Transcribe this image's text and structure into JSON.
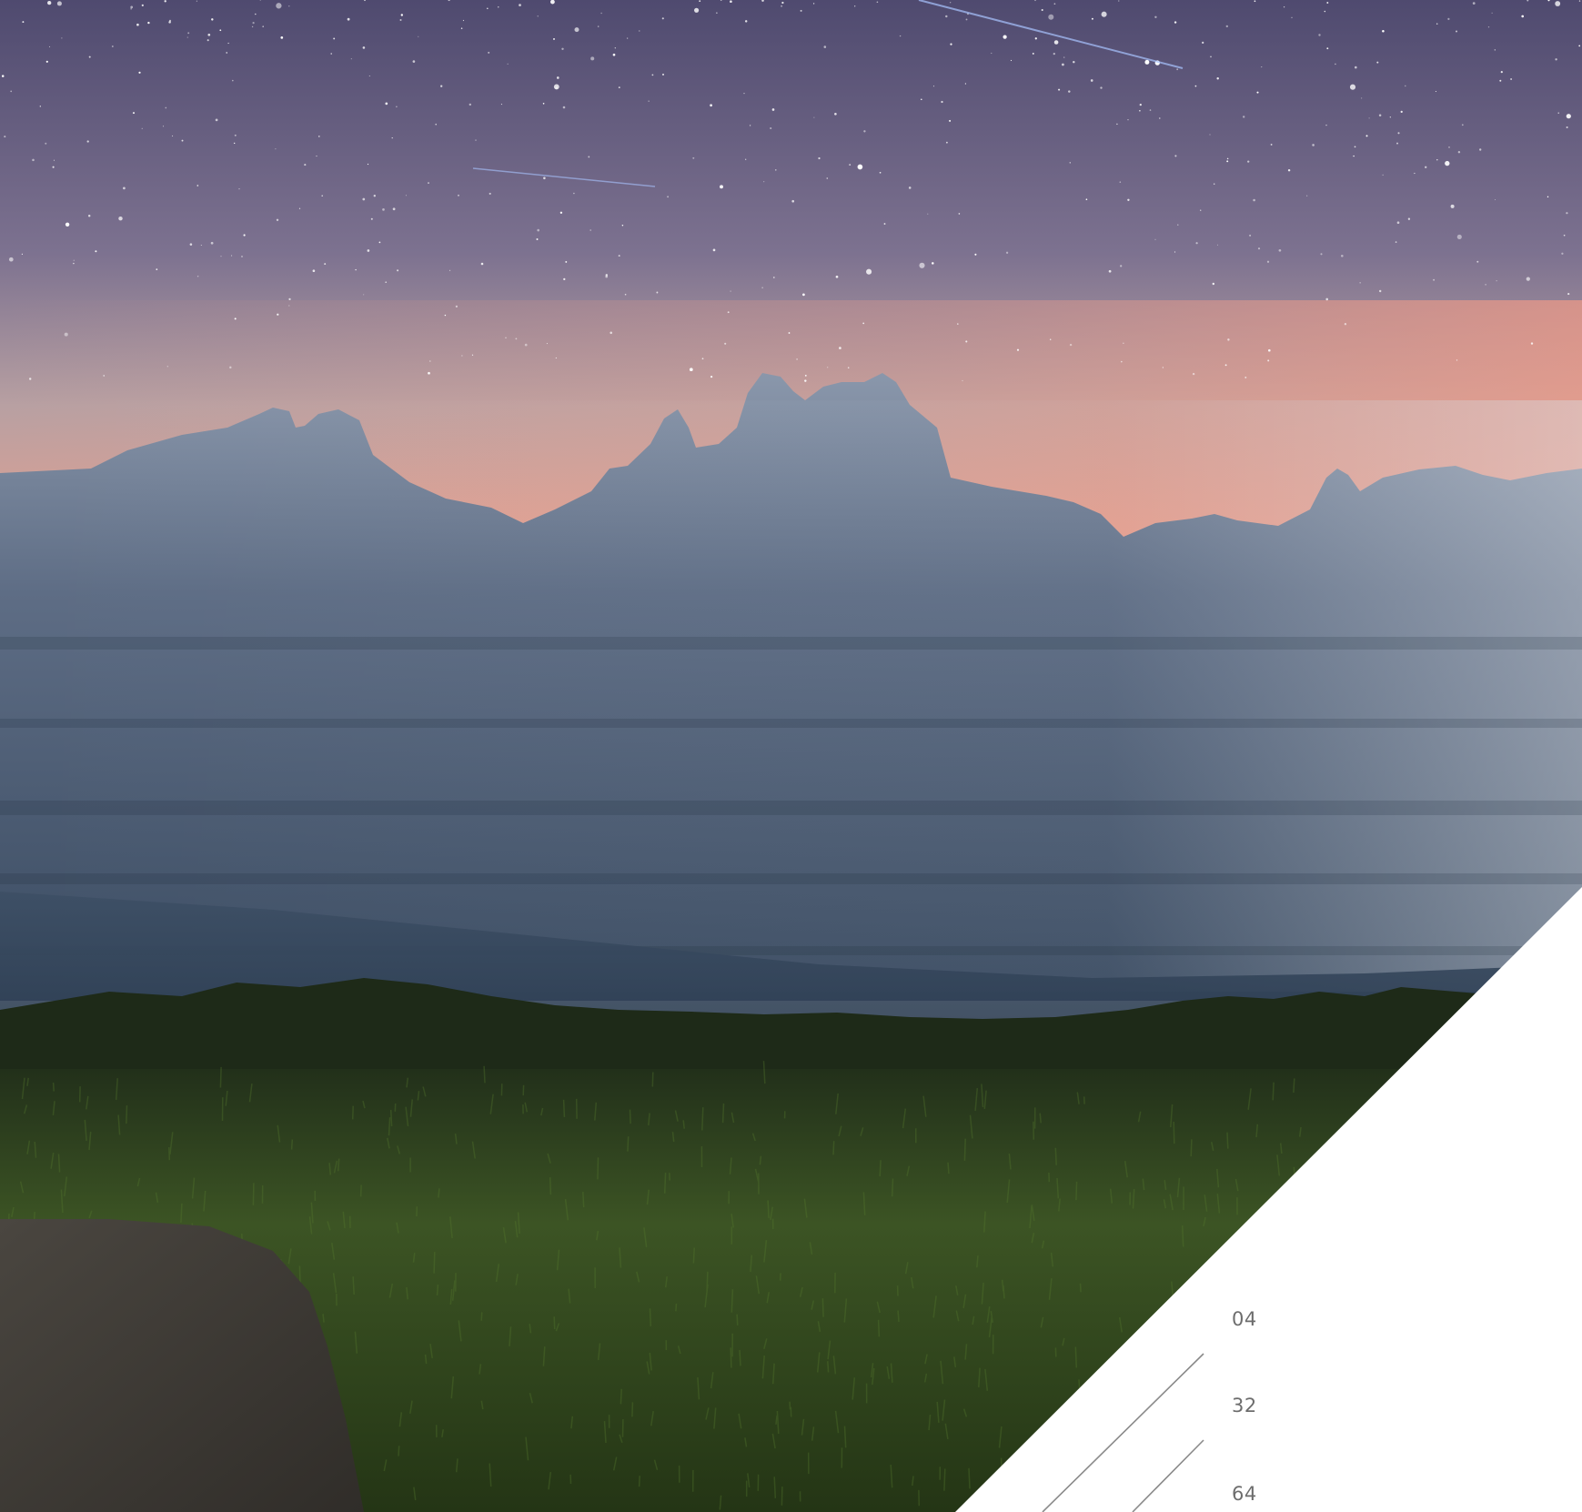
{
  "colors": {
    "sky_top": "#4f4a6f",
    "sky_mid": "#8d8197",
    "horizon_glow": "#e7a08f",
    "mountain_far": "#5d6c83",
    "mountain_near": "#34455a",
    "grass_dark": "#1f2e16",
    "grass_light": "#4a6a27",
    "path": "#3e3a35",
    "panel": "#ffffff",
    "divider": "#8a8a8a",
    "number_text": "#6d6d6d"
  },
  "toc": {
    "page_numbers": [
      "04",
      "32",
      "64"
    ]
  }
}
